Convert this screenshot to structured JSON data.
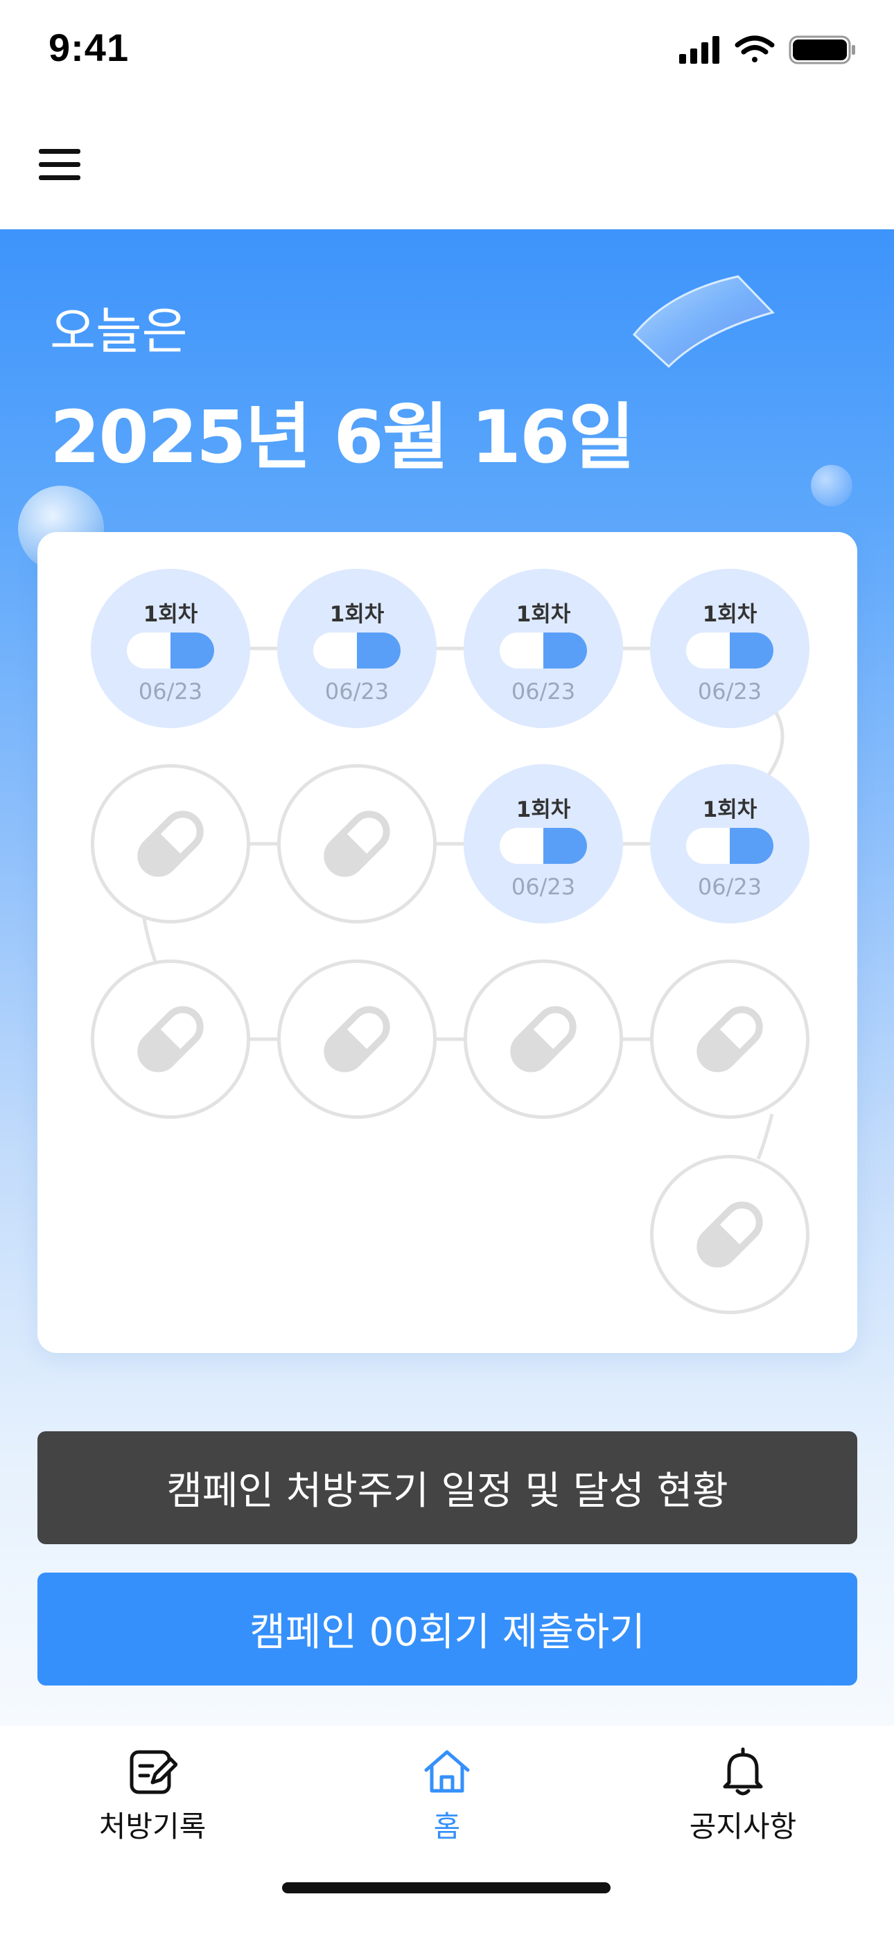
{
  "status_bar": {
    "time": "9:41"
  },
  "header": {
    "menu_icon": "hamburger-icon"
  },
  "hero": {
    "subtitle": "오늘은",
    "date": "2025년 6월 16일"
  },
  "progress": {
    "nodes": [
      {
        "status": "done",
        "label": "1회차",
        "date": "06/23"
      },
      {
        "status": "done",
        "label": "1회차",
        "date": "06/23"
      },
      {
        "status": "done",
        "label": "1회차",
        "date": "06/23"
      },
      {
        "status": "done",
        "label": "1회차",
        "date": "06/23"
      },
      {
        "status": "done",
        "label": "1회차",
        "date": "06/23"
      },
      {
        "status": "done",
        "label": "1회차",
        "date": "06/23"
      },
      {
        "status": "pending"
      },
      {
        "status": "pending"
      },
      {
        "status": "pending"
      },
      {
        "status": "pending"
      },
      {
        "status": "pending"
      },
      {
        "status": "pending"
      },
      {
        "status": "pending"
      }
    ]
  },
  "buttons": {
    "schedule": "캠페인 처방주기 일정 및 달성 현황",
    "submit": "캠페인 00회기 제출하기"
  },
  "tabs": [
    {
      "label": "처방기록",
      "icon": "prescription-edit-icon",
      "active": false
    },
    {
      "label": "홈",
      "icon": "home-icon",
      "active": true
    },
    {
      "label": "공지사항",
      "icon": "bell-icon",
      "active": false
    }
  ],
  "colors": {
    "accent": "#3590fb",
    "dark_button": "#444444",
    "done_node": "#dde9fe",
    "pending_border": "#e2e2e2"
  }
}
